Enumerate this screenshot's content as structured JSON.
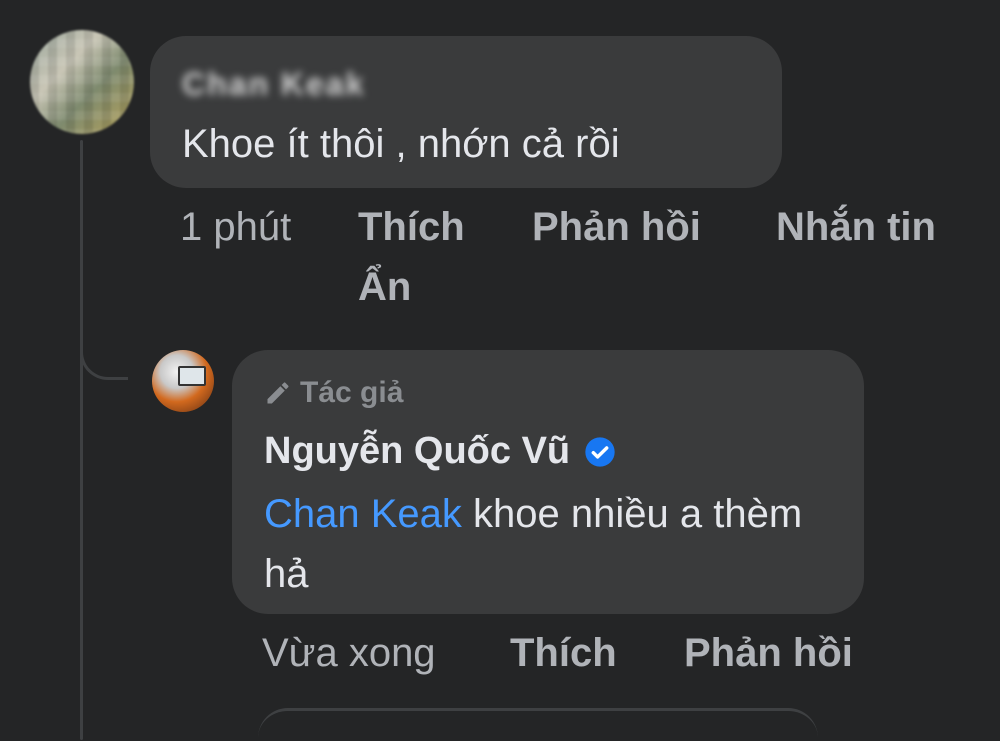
{
  "comment": {
    "author_blurred": "Chan Keak",
    "text": "Khoe ít thôi , nhớn cả rồi",
    "time": "1 phút",
    "actions": {
      "like": "Thích",
      "reply": "Phản hồi",
      "message": "Nhắn tin",
      "hide": "Ẩn"
    }
  },
  "reply": {
    "badge": "Tác giả",
    "author": "Nguyễn Quốc Vũ",
    "mention": "Chan Keak",
    "text": " khoe nhiều a thèm hả",
    "time": "Vừa xong",
    "actions": {
      "like": "Thích",
      "reply": "Phản hồi"
    }
  },
  "icons": {
    "badge_icon": "pencil-icon",
    "verified_icon": "verified-badge-icon"
  },
  "colors": {
    "background": "#242526",
    "bubble": "#3a3b3c",
    "mention": "#4599ff",
    "verified": "#1877f2",
    "muted_text": "#b0b3b8"
  }
}
